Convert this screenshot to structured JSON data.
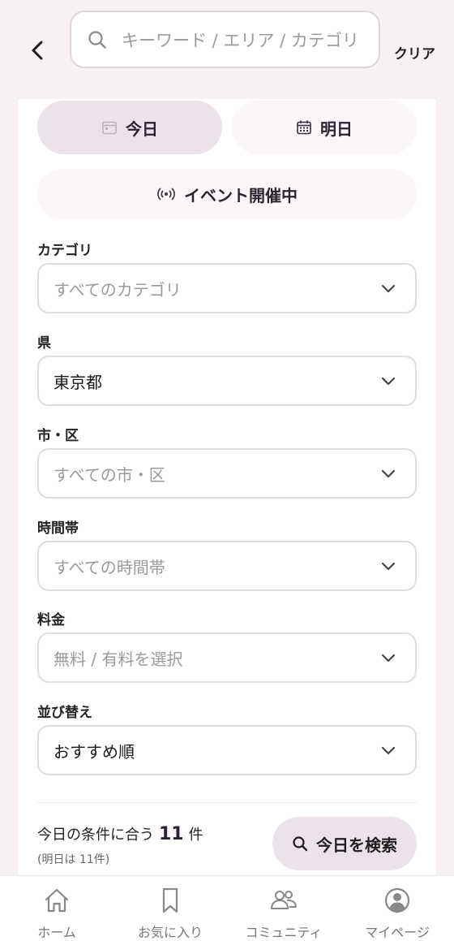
{
  "header": {
    "search_placeholder": "キーワード / エリア / カテゴリ",
    "clear_label": "クリア"
  },
  "day_toggle": {
    "today_label": "今日",
    "tomorrow_label": "明日",
    "selected": "today"
  },
  "event_toggle": {
    "label": "イベント開催中"
  },
  "filters": {
    "category": {
      "label": "カテゴリ",
      "value": "すべてのカテゴリ"
    },
    "prefecture": {
      "label": "県",
      "value": "東京都"
    },
    "city": {
      "label": "市・区",
      "value": "すべての市・区"
    },
    "time": {
      "label": "時間帯",
      "value": "すべての時間帯"
    },
    "price": {
      "label": "料金",
      "value": "無料 / 有料を選択"
    },
    "sort": {
      "label": "並び替え",
      "value": "おすすめ順"
    }
  },
  "result": {
    "prefix": "今日の条件に合う",
    "count": "11",
    "suffix": "件",
    "sub": "(明日は 11件)",
    "search_button": "今日を検索"
  },
  "bottom_nav": {
    "home": "ホーム",
    "favorites": "お気に入り",
    "community": "コミュニティ",
    "mypage": "マイページ"
  },
  "colors": {
    "accent_bg": "#ece2ea",
    "page_bg": "#f8f1f4",
    "accent_text": "#2a1e31"
  }
}
